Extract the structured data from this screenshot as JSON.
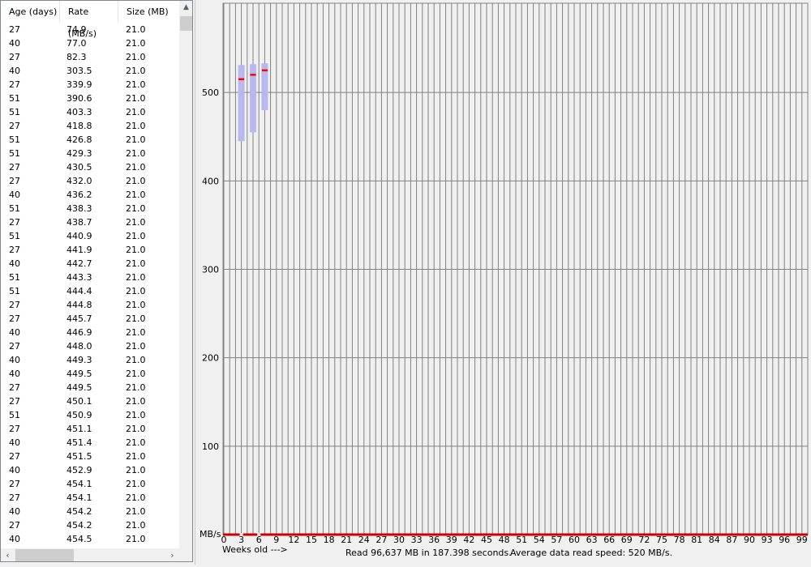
{
  "table": {
    "columns": [
      "Age (days)",
      "Rate (MB/s)",
      "Size (MB)"
    ],
    "rows": [
      [
        "27",
        "74.9",
        "21.0"
      ],
      [
        "40",
        "77.0",
        "21.0"
      ],
      [
        "27",
        "82.3",
        "21.0"
      ],
      [
        "40",
        "303.5",
        "21.0"
      ],
      [
        "27",
        "339.9",
        "21.0"
      ],
      [
        "51",
        "390.6",
        "21.0"
      ],
      [
        "51",
        "403.3",
        "21.0"
      ],
      [
        "27",
        "418.8",
        "21.0"
      ],
      [
        "51",
        "426.8",
        "21.0"
      ],
      [
        "51",
        "429.3",
        "21.0"
      ],
      [
        "27",
        "430.5",
        "21.0"
      ],
      [
        "27",
        "432.0",
        "21.0"
      ],
      [
        "40",
        "436.2",
        "21.0"
      ],
      [
        "51",
        "438.3",
        "21.0"
      ],
      [
        "27",
        "438.7",
        "21.0"
      ],
      [
        "51",
        "440.9",
        "21.0"
      ],
      [
        "27",
        "441.9",
        "21.0"
      ],
      [
        "40",
        "442.7",
        "21.0"
      ],
      [
        "51",
        "443.3",
        "21.0"
      ],
      [
        "51",
        "444.4",
        "21.0"
      ],
      [
        "27",
        "444.8",
        "21.0"
      ],
      [
        "27",
        "445.7",
        "21.0"
      ],
      [
        "40",
        "446.9",
        "21.0"
      ],
      [
        "27",
        "448.0",
        "21.0"
      ],
      [
        "40",
        "449.3",
        "21.0"
      ],
      [
        "40",
        "449.5",
        "21.0"
      ],
      [
        "27",
        "449.5",
        "21.0"
      ],
      [
        "27",
        "450.1",
        "21.0"
      ],
      [
        "51",
        "450.9",
        "21.0"
      ],
      [
        "27",
        "451.1",
        "21.0"
      ],
      [
        "40",
        "451.4",
        "21.0"
      ],
      [
        "27",
        "451.5",
        "21.0"
      ],
      [
        "40",
        "452.9",
        "21.0"
      ],
      [
        "27",
        "454.1",
        "21.0"
      ],
      [
        "27",
        "454.1",
        "21.0"
      ],
      [
        "40",
        "454.2",
        "21.0"
      ],
      [
        "27",
        "454.2",
        "21.0"
      ],
      [
        "40",
        "454.5",
        "21.0"
      ]
    ]
  },
  "scrollbars": {
    "up_icon": "scroll-up-arrow",
    "left_icon": "scroll-left-arrow",
    "right_icon": "scroll-right-arrow",
    "up_glyph": "▲",
    "left_glyph": "‹",
    "right_glyph": "›"
  },
  "status": {
    "read_text": "Read 96,637 MB in 187.398 seconds.",
    "avg_text": "Average data read speed: 520 MB/s."
  },
  "chart_data": {
    "type": "box",
    "xlabel": "Weeks old --->",
    "ylabel": "MB/s",
    "x_ticks": [
      0,
      3,
      6,
      9,
      12,
      15,
      18,
      21,
      24,
      27,
      30,
      33,
      36,
      39,
      42,
      45,
      48,
      51,
      54,
      57,
      60,
      63,
      66,
      69,
      72,
      75,
      78,
      81,
      84,
      87,
      90,
      93,
      96,
      99
    ],
    "y_ticks": [
      100,
      200,
      300,
      400,
      500
    ],
    "xlim": [
      0,
      99
    ],
    "ylim": [
      0,
      600
    ],
    "grid": true,
    "boxes": [
      {
        "week": 3.0,
        "low": 445,
        "high": 531,
        "median": 515
      },
      {
        "week": 5.0,
        "low": 455,
        "high": 532,
        "median": 520
      },
      {
        "week": 7.0,
        "low": 480,
        "high": 533,
        "median": 525
      }
    ],
    "baseline_dashes": [
      3,
      6
    ],
    "colors": {
      "grid": "#808080",
      "box": "#b8b8ee",
      "median": "#ff0000",
      "baseline": "#cc0000"
    }
  }
}
